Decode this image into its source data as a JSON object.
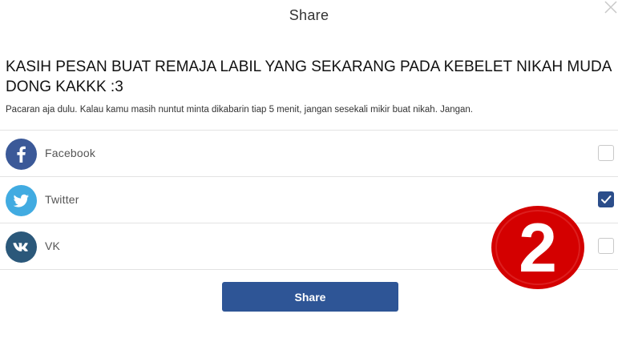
{
  "dialog": {
    "title": "Share"
  },
  "post": {
    "title": "KASIH PESAN BUAT REMAJA LABIL YANG SEKARANG PADA KEBELET NIKAH MUDA DONG KAKKK :3",
    "description": "Pacaran aja dulu. Kalau kamu masih nuntut minta dikabarin tiap 5 menit, jangan sesekali mikir buat nikah. Jangan."
  },
  "networks": [
    {
      "label": "Facebook",
      "icon": "facebook-icon",
      "color": "#3b5998",
      "checked": false
    },
    {
      "label": "Twitter",
      "icon": "twitter-icon",
      "color": "#41abe1",
      "checked": true
    },
    {
      "label": "VK",
      "icon": "vk-icon",
      "color": "#2b587a",
      "checked": false
    }
  ],
  "annotation": {
    "number": "2",
    "color": "#d40000"
  },
  "actions": {
    "share_label": "Share",
    "accent": "#2e5596"
  }
}
